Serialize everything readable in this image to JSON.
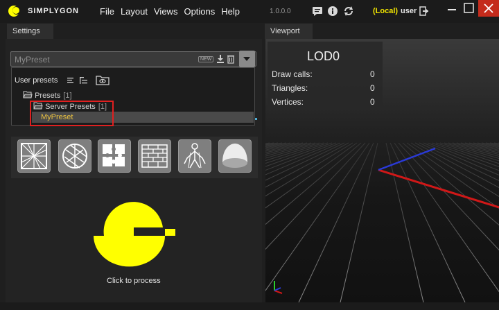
{
  "app": {
    "brand": "SIMPLYGON",
    "version": "1.0.0.0",
    "local_label": "(Local)",
    "user_label": "user"
  },
  "menu": [
    "File",
    "Layout",
    "Views",
    "Options",
    "Help"
  ],
  "tabs": {
    "settings": "Settings",
    "viewport": "Viewport"
  },
  "preset": {
    "current": "MyPreset",
    "new_badge": "NEW"
  },
  "user_presets": {
    "label": "User presets",
    "tree": [
      {
        "label": "Presets",
        "count": "[1]"
      },
      {
        "label": "Server Presets",
        "count": "[1]"
      },
      {
        "label": "MyPreset"
      }
    ]
  },
  "process": {
    "label": "Click to process"
  },
  "stats": {
    "title": "LOD0",
    "rows": [
      {
        "label": "Draw calls:",
        "value": "0"
      },
      {
        "label": "Triangles:",
        "value": "0"
      },
      {
        "label": "Vertices:",
        "value": "0"
      }
    ]
  },
  "colors": {
    "accent": "#ffff00",
    "close": "#c42b1c",
    "highlight_box": "#e02020",
    "selected_text": "#e8c040"
  },
  "icons": [
    "chat-icon",
    "info-icon",
    "sync-icon",
    "logout-icon",
    "minimize-icon",
    "maximize-icon",
    "close-icon"
  ]
}
